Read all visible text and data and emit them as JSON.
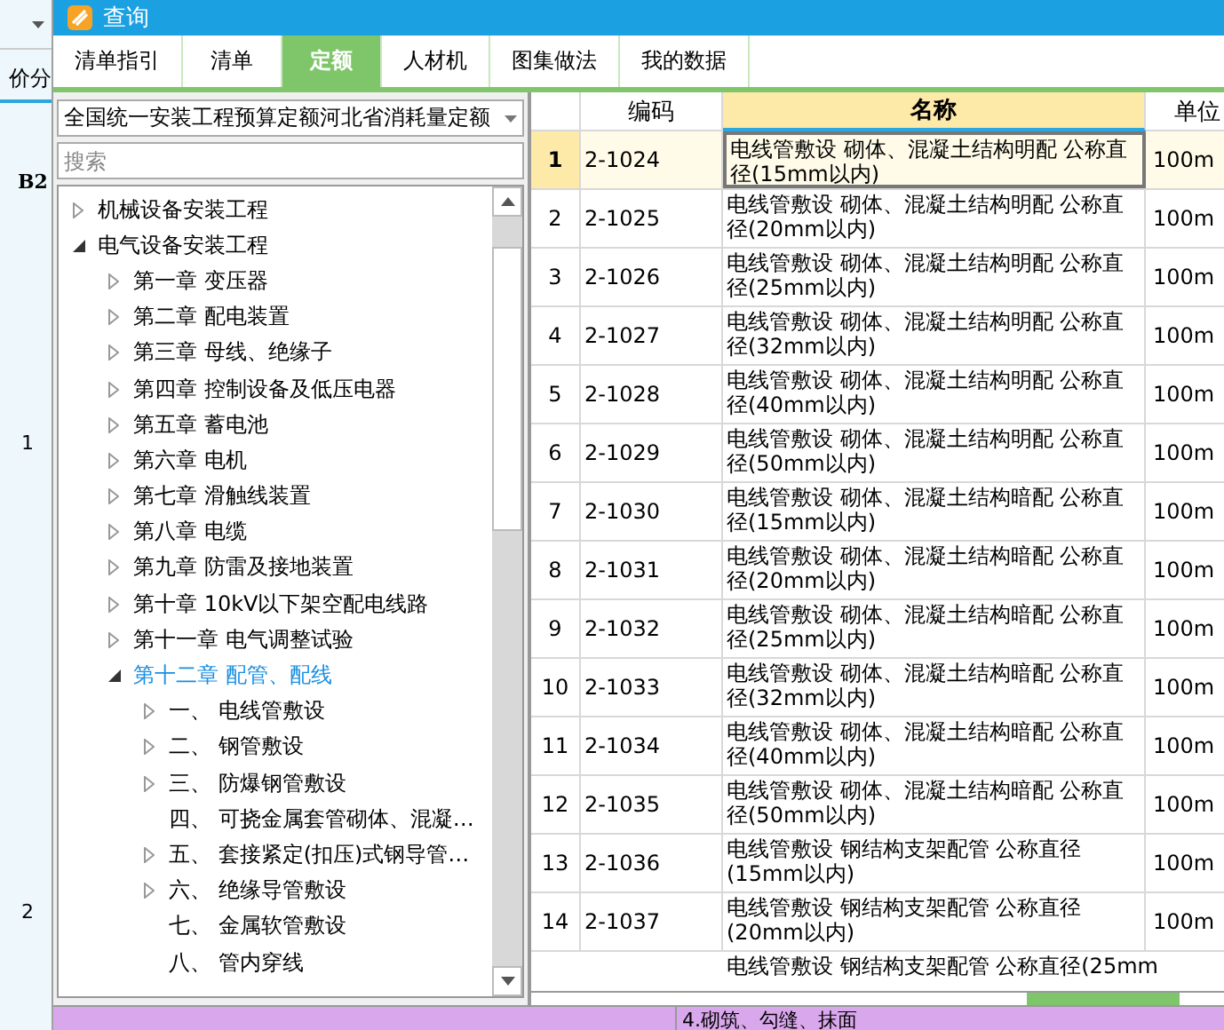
{
  "background": {
    "header_text": "价分",
    "column_label": "B2",
    "row_numbers": [
      "1",
      "2"
    ],
    "footer_text": "4.砌筑、勾缝、抹面"
  },
  "window": {
    "title": "查询"
  },
  "tabs": [
    {
      "label": "清单指引",
      "selected": false
    },
    {
      "label": "清单",
      "selected": false
    },
    {
      "label": "定额",
      "selected": true
    },
    {
      "label": "人材机",
      "selected": false
    },
    {
      "label": "图集做法",
      "selected": false
    },
    {
      "label": "我的数据",
      "selected": false
    }
  ],
  "library_select": {
    "value": "全国统一安装工程预算定额河北省消耗量定额"
  },
  "search": {
    "placeholder": "搜索"
  },
  "tree": [
    {
      "label": "机械设备安装工程",
      "expanded": false,
      "has_children": true,
      "selected": false
    },
    {
      "label": "电气设备安装工程",
      "expanded": true,
      "has_children": true,
      "selected": false,
      "children": [
        {
          "label": "第一章 变压器",
          "expanded": false,
          "has_children": true,
          "selected": false
        },
        {
          "label": "第二章 配电装置",
          "expanded": false,
          "has_children": true,
          "selected": false
        },
        {
          "label": "第三章 母线、绝缘子",
          "expanded": false,
          "has_children": true,
          "selected": false
        },
        {
          "label": "第四章 控制设备及低压电器",
          "expanded": false,
          "has_children": true,
          "selected": false
        },
        {
          "label": "第五章 蓄电池",
          "expanded": false,
          "has_children": true,
          "selected": false
        },
        {
          "label": "第六章 电机",
          "expanded": false,
          "has_children": true,
          "selected": false
        },
        {
          "label": "第七章 滑触线装置",
          "expanded": false,
          "has_children": true,
          "selected": false
        },
        {
          "label": "第八章 电缆",
          "expanded": false,
          "has_children": true,
          "selected": false
        },
        {
          "label": "第九章 防雷及接地装置",
          "expanded": false,
          "has_children": true,
          "selected": false
        },
        {
          "label": "第十章 10kV以下架空配电线路",
          "expanded": false,
          "has_children": true,
          "selected": false
        },
        {
          "label": "第十一章 电气调整试验",
          "expanded": false,
          "has_children": true,
          "selected": false
        },
        {
          "label": "第十二章 配管、配线",
          "expanded": true,
          "has_children": true,
          "selected": true,
          "children": [
            {
              "label": "一、 电线管敷设",
              "expanded": false,
              "has_children": true,
              "selected": false
            },
            {
              "label": "二、 钢管敷设",
              "expanded": false,
              "has_children": true,
              "selected": false
            },
            {
              "label": "三、 防爆钢管敷设",
              "expanded": false,
              "has_children": true,
              "selected": false
            },
            {
              "label": "四、 可挠金属套管砌体、混凝…",
              "expanded": false,
              "has_children": false,
              "selected": false
            },
            {
              "label": "五、 套接紧定(扣压)式钢导管…",
              "expanded": false,
              "has_children": true,
              "selected": false
            },
            {
              "label": "六、 绝缘导管敷设",
              "expanded": false,
              "has_children": true,
              "selected": false
            },
            {
              "label": "七、 金属软管敷设",
              "expanded": false,
              "has_children": false,
              "selected": false
            },
            {
              "label": "八、 管内穿线",
              "expanded": false,
              "has_children": false,
              "selected": false
            }
          ]
        }
      ]
    }
  ],
  "table": {
    "columns": [
      "编码",
      "名称",
      "单位"
    ],
    "rows": [
      {
        "number": "1",
        "code": "2-1024",
        "name": "电线管敷设 砌体、混凝土结构明配 公称直径(15mm以内)",
        "unit": "100m",
        "selected": true
      },
      {
        "number": "2",
        "code": "2-1025",
        "name": "电线管敷设 砌体、混凝土结构明配 公称直径(20mm以内)",
        "unit": "100m",
        "selected": false
      },
      {
        "number": "3",
        "code": "2-1026",
        "name": "电线管敷设 砌体、混凝土结构明配 公称直径(25mm以内)",
        "unit": "100m",
        "selected": false
      },
      {
        "number": "4",
        "code": "2-1027",
        "name": "电线管敷设 砌体、混凝土结构明配 公称直径(32mm以内)",
        "unit": "100m",
        "selected": false
      },
      {
        "number": "5",
        "code": "2-1028",
        "name": "电线管敷设 砌体、混凝土结构明配 公称直径(40mm以内)",
        "unit": "100m",
        "selected": false
      },
      {
        "number": "6",
        "code": "2-1029",
        "name": "电线管敷设 砌体、混凝土结构明配 公称直径(50mm以内)",
        "unit": "100m",
        "selected": false
      },
      {
        "number": "7",
        "code": "2-1030",
        "name": "电线管敷设 砌体、混凝土结构暗配 公称直径(15mm以内)",
        "unit": "100m",
        "selected": false
      },
      {
        "number": "8",
        "code": "2-1031",
        "name": "电线管敷设 砌体、混凝土结构暗配 公称直径(20mm以内)",
        "unit": "100m",
        "selected": false
      },
      {
        "number": "9",
        "code": "2-1032",
        "name": "电线管敷设 砌体、混凝土结构暗配 公称直径(25mm以内)",
        "unit": "100m",
        "selected": false
      },
      {
        "number": "10",
        "code": "2-1033",
        "name": "电线管敷设 砌体、混凝土结构暗配 公称直径(32mm以内)",
        "unit": "100m",
        "selected": false
      },
      {
        "number": "11",
        "code": "2-1034",
        "name": "电线管敷设 砌体、混凝土结构暗配 公称直径(40mm以内)",
        "unit": "100m",
        "selected": false
      },
      {
        "number": "12",
        "code": "2-1035",
        "name": "电线管敷设 砌体、混凝土结构暗配 公称直径(50mm以内)",
        "unit": "100m",
        "selected": false
      },
      {
        "number": "13",
        "code": "2-1036",
        "name": "电线管敷设 钢结构支架配管 公称直径(15mm以内)",
        "unit": "100m",
        "selected": false
      },
      {
        "number": "14",
        "code": "2-1037",
        "name": "电线管敷设 钢结构支架配管 公称直径(20mm以内)",
        "unit": "100m",
        "selected": false
      },
      {
        "name": "电线管敷设 钢结构支架配管 公称直径(25mm",
        "selected": false
      }
    ]
  }
}
